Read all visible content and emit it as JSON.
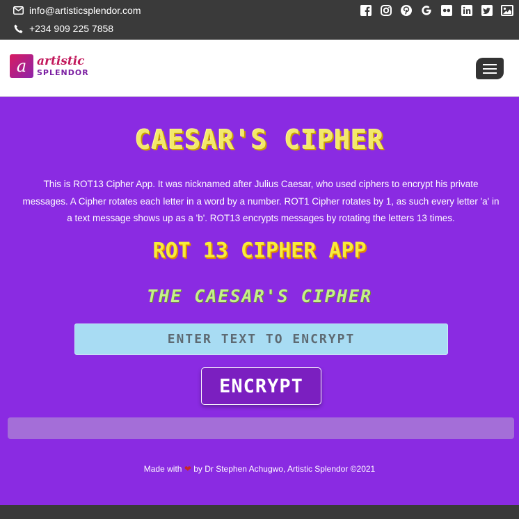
{
  "topbar": {
    "email": "info@artisticsplendor.com",
    "phone": "+234 909 225 7858",
    "social_icons": [
      "facebook-icon",
      "instagram-icon",
      "pinterest-icon",
      "google-icon",
      "flickr-icon",
      "linkedin-icon",
      "twitter-icon",
      "image-icon"
    ]
  },
  "navbar": {
    "logo_line1": "artistic",
    "logo_line2": "SPLENDOR"
  },
  "main": {
    "title": "CAESAR'S CIPHER",
    "description": "This is ROT13 Cipher App. It was nicknamed after Julius Caesar, who used ciphers to encrypt his private messages. A Cipher rotates each letter in a word by a number. ROT1 Cipher rotates by 1, as such every letter 'a' in a text message shows up as a 'b'. ROT13 encrypts messages by rotating the letters 13 times.",
    "subtitle": "ROT 13 CIPHER APP",
    "subtitle2": "THE CAESAR'S CIPHER",
    "input_placeholder": "ENTER TEXT TO ENCRYPT",
    "input_value": "",
    "button_label": "ENCRYPT",
    "output_text": ""
  },
  "footer": {
    "made_with": "Made with",
    "heart": "❤",
    "credit": "by Dr Stephen Achugwo, Artistic Splendor ©2021"
  },
  "colors": {
    "main_bg": "#8a2be2",
    "topbar_bg": "#3a3a3a",
    "title": "#f3e86b",
    "input_bg": "#a8dcf3"
  }
}
